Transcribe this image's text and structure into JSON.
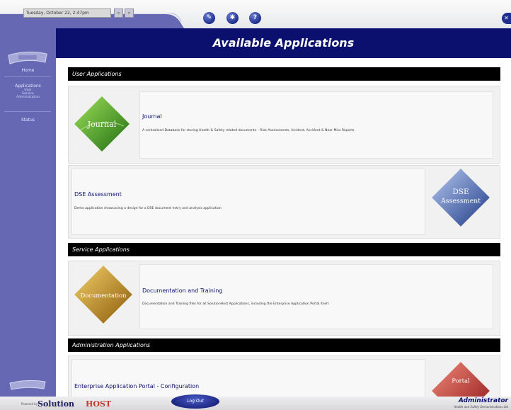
{
  "topbar": {
    "date": "Tuesday, October 22, 2:47pm",
    "back_icon": "back-arrows-icon",
    "forward_icon": "forward-arrows-icon",
    "tools": [
      {
        "icon": "tools-icon",
        "glyph": "✎"
      },
      {
        "icon": "settings-icon",
        "glyph": "✱"
      },
      {
        "icon": "help-icon",
        "glyph": "?"
      }
    ],
    "close_glyph": "✕"
  },
  "sidebar": {
    "items": [
      {
        "label": "Home"
      },
      {
        "label": "Applications",
        "sub": [
          "User",
          "Service",
          "Administration"
        ]
      },
      {
        "label": "Status"
      }
    ]
  },
  "header": {
    "title": "Available Applications"
  },
  "sections": [
    {
      "title": "User Applications"
    },
    {
      "title": "Service Applications"
    },
    {
      "title": "Administration Applications"
    }
  ],
  "apps": {
    "journal": {
      "title": "Journal",
      "desc": "A centralised Database for storing Health & Safety related documents – Risk Assessments, Incident, Accident & Near Miss Reports",
      "logo_text": "Journal",
      "color": "#3f9a2a"
    },
    "dse": {
      "title": "DSE Assessment",
      "desc": "Demo application showcasing a design for a DSE document entry and analysis application.",
      "logo_line1": "DSE",
      "logo_line2": "Assessment",
      "color": "#3a56a8"
    },
    "docs": {
      "title": "Documentation and Training",
      "desc": "Documentation and Training files for all SolutionHost Applications, including the Enterprise Application Portal itself.",
      "logo_text": "Documentation",
      "color": "#c98a1a"
    },
    "portal": {
      "title": "Enterprise Application Portal - Configuration",
      "logo_text": "Portal",
      "color": "#c0282b"
    }
  },
  "footer": {
    "powered_by": "Powered by",
    "brand_1": "Solution",
    "brand_2": "HOST",
    "logout": "Log Out",
    "user_name": "Administrator",
    "user_org": "Health and Safety Demonstrations Ltd"
  }
}
